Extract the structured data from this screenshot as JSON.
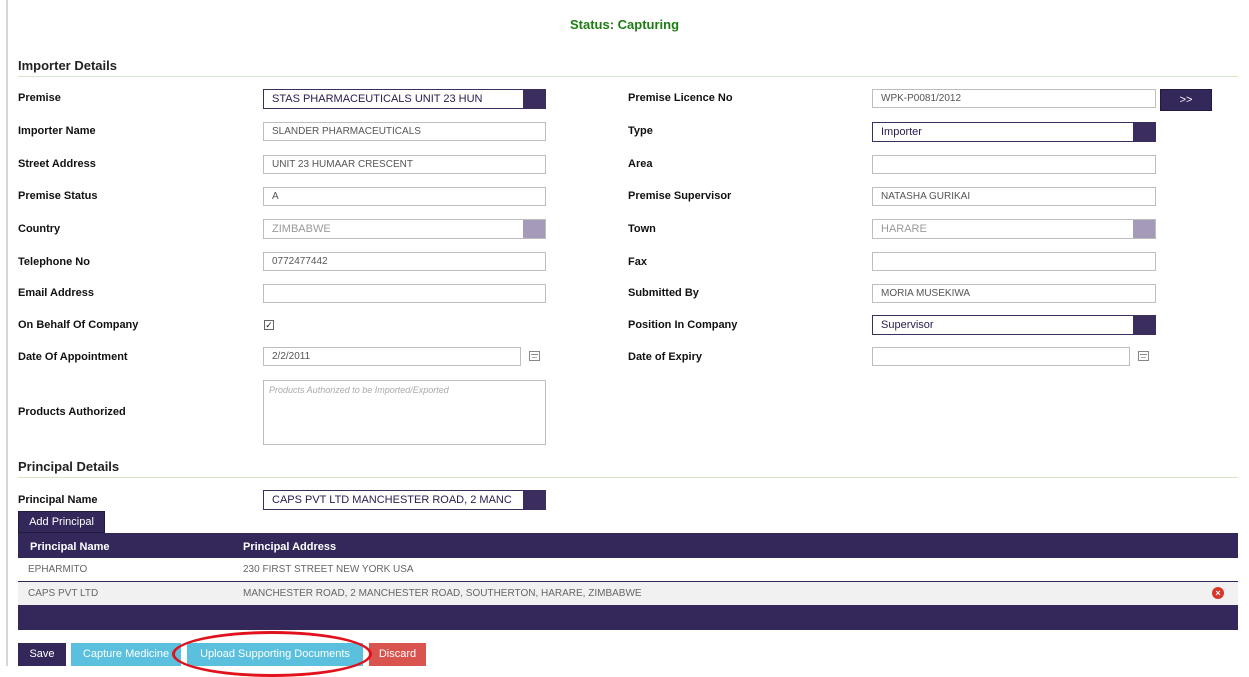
{
  "status": "Status: Capturing",
  "importer_section": {
    "title": "Importer Details"
  },
  "fields": {
    "premise": {
      "label": "Premise",
      "value": "STAS PHARMACEUTICALS UNIT 23 HUN"
    },
    "premise_licence_no": {
      "label": "Premise Licence No",
      "value": "WPK-P0081/2012",
      "button": ">>"
    },
    "importer_name": {
      "label": "Importer Name",
      "value": "SLANDER PHARMACEUTICALS"
    },
    "type": {
      "label": "Type",
      "value": "Importer"
    },
    "street_address": {
      "label": "Street Address",
      "value": "UNIT 23 HUMAAR CRESCENT"
    },
    "area": {
      "label": "Area",
      "value": ""
    },
    "premise_status": {
      "label": "Premise Status",
      "value": "A"
    },
    "premise_supervisor": {
      "label": "Premise Supervisor",
      "value": "NATASHA GURIKAI"
    },
    "country": {
      "label": "Country",
      "value": "ZIMBABWE"
    },
    "town": {
      "label": "Town",
      "value": "HARARE"
    },
    "telephone_no": {
      "label": "Telephone No",
      "value": "0772477442"
    },
    "fax": {
      "label": "Fax",
      "value": ""
    },
    "email_address": {
      "label": "Email Address",
      "value": ""
    },
    "submitted_by": {
      "label": "Submitted By",
      "value": "MORIA MUSEKIWA"
    },
    "on_behalf_of_company": {
      "label": "On Behalf Of Company",
      "check": "✓"
    },
    "position_in_company": {
      "label": "Position In Company",
      "value": "Supervisor"
    },
    "date_of_appointment": {
      "label": "Date Of Appointment",
      "value": "2/2/2011"
    },
    "date_of_expiry": {
      "label": "Date of Expiry",
      "value": ""
    },
    "products_authorized": {
      "label": "Products Authorized",
      "placeholder": "Products Authorized to be Imported/Exported"
    }
  },
  "principal_section": {
    "title": "Principal Details",
    "principal_name_label": "Principal Name",
    "principal_name_value": "CAPS PVT LTD MANCHESTER ROAD, 2 MANC",
    "add_button": "Add Principal"
  },
  "principal_table": {
    "headers": [
      "Principal Name",
      "Principal Address"
    ],
    "rows": [
      {
        "name": "EPHARMITO",
        "address": "230 FIRST STREET NEW YORK USA"
      },
      {
        "name": "CAPS PVT LTD",
        "address": "MANCHESTER ROAD, 2 MANCHESTER ROAD, SOUTHERTON, HARARE, ZIMBABWE"
      }
    ]
  },
  "actions": {
    "save": "Save",
    "capture_medicine": "Capture Medicine",
    "upload_documents": "Upload Supporting Documents",
    "discard": "Discard"
  },
  "colors": {
    "brand_purple": "#34285a",
    "status_green": "#1d7d12",
    "info_blue": "#5bc0de",
    "danger_red": "#d9534f",
    "annotation_red": "#e1121b"
  }
}
